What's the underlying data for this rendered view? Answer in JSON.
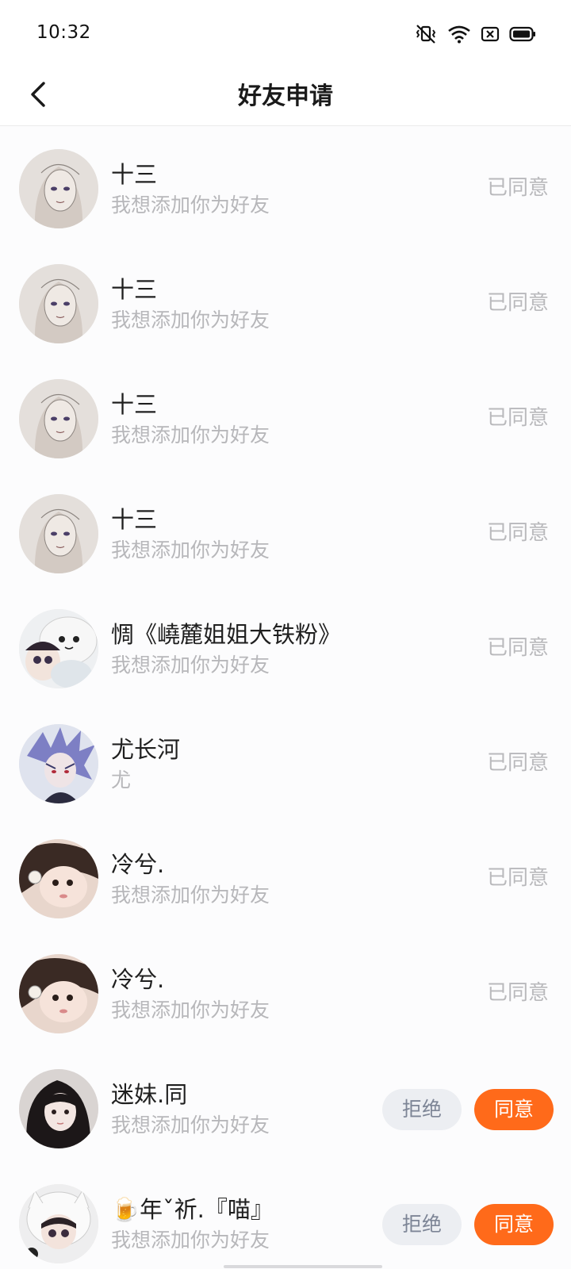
{
  "status_bar": {
    "time": "10:32",
    "icons": [
      "vibrate-icon",
      "wifi-icon",
      "sim-blocked-icon",
      "battery-icon"
    ]
  },
  "header": {
    "back_icon": "chevron-left-icon",
    "title": "好友申请"
  },
  "colors": {
    "accent": "#ff6a1a",
    "reject_bg": "#eceef2",
    "status_gray": "#b9b9bc"
  },
  "requests": [
    {
      "name": "十三",
      "message": "我想添加你为好友",
      "status": "已同意",
      "avatar": "sketch-girl-avatar"
    },
    {
      "name": "十三",
      "message": "我想添加你为好友",
      "status": "已同意",
      "avatar": "sketch-girl-avatar"
    },
    {
      "name": "十三",
      "message": "我想添加你为好友",
      "status": "已同意",
      "avatar": "sketch-girl-avatar"
    },
    {
      "name": "十三",
      "message": "我想添加你为好友",
      "status": "已同意",
      "avatar": "sketch-girl-avatar"
    },
    {
      "name": "惆《嶢麓姐姐大铁粉》",
      "message": "我想添加你为好友",
      "status": "已同意",
      "avatar": "doll-with-hood-avatar"
    },
    {
      "name": "尤长河",
      "message": "尤",
      "status": "已同意",
      "avatar": "anime-boy-avatar"
    },
    {
      "name": "冷兮.",
      "message": "我想添加你为好友",
      "status": "已同意",
      "avatar": "girl-photo-avatar"
    },
    {
      "name": "冷兮.",
      "message": "我想添加你为好友",
      "status": "已同意",
      "avatar": "girl-photo-avatar"
    },
    {
      "name": "迷妹.同",
      "message": "我想添加你为好友",
      "reject_label": "拒绝",
      "accept_label": "同意",
      "avatar": "dark-hair-girl-avatar"
    },
    {
      "name": "🍺年ˇ祈.『喵』",
      "message": "我想添加你为好友",
      "reject_label": "拒绝",
      "accept_label": "同意",
      "avatar": "doll-white-hood-avatar"
    }
  ]
}
